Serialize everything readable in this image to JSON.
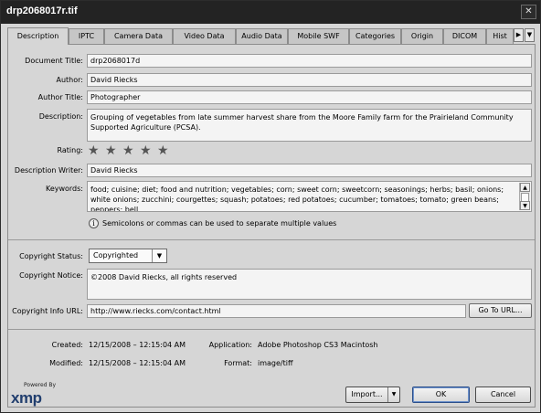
{
  "window": {
    "title": "drp2068017r.tif",
    "close_glyph": "✕"
  },
  "tabs": [
    {
      "label": "Description"
    },
    {
      "label": "IPTC"
    },
    {
      "label": "Camera Data"
    },
    {
      "label": "Video Data"
    },
    {
      "label": "Audio Data"
    },
    {
      "label": "Mobile SWF"
    },
    {
      "label": "Categories"
    },
    {
      "label": "Origin"
    },
    {
      "label": "DICOM"
    },
    {
      "label": "Hist"
    }
  ],
  "tab_nav": {
    "next_glyph": "▶",
    "menu_glyph": "▼"
  },
  "fields": {
    "document_title": {
      "label": "Document Title:",
      "value": "drp2068017d"
    },
    "author": {
      "label": "Author:",
      "value": "David Riecks"
    },
    "author_title": {
      "label": "Author Title:",
      "value": "Photographer"
    },
    "description": {
      "label": "Description:",
      "value": "Grouping of vegetables from late summer harvest share from the Moore Family farm for the Prairieland Community Supported Agriculture (PCSA)."
    },
    "rating": {
      "label": "Rating:",
      "stars": 0,
      "max": 5,
      "star_glyph": "★"
    },
    "description_writer": {
      "label": "Description Writer:",
      "value": "David Riecks"
    },
    "keywords": {
      "label": "Keywords:",
      "value": "food; cuisine; diet; food and nutrition; vegetables; corn; sweet corn; sweetcorn; seasonings; herbs; basil; onions; white onions; zucchini; courgettes; squash; potatoes; red potatoes; cucumber; tomatoes; tomato; green beans; peppers; bell"
    },
    "keywords_hint": "Semicolons or commas can be used to separate multiple values",
    "copyright_status": {
      "label": "Copyright Status:",
      "value": "Copyrighted"
    },
    "copyright_notice": {
      "label": "Copyright Notice:",
      "value": "©2008 David Riecks, all rights reserved"
    },
    "copyright_url": {
      "label": "Copyright Info URL:",
      "value": "http://www.riecks.com/contact.html",
      "button": "Go To URL..."
    }
  },
  "meta": {
    "created_label": "Created:",
    "created_value": "12/15/2008 – 12:15:04 AM",
    "modified_label": "Modified:",
    "modified_value": "12/15/2008 – 12:15:04 AM",
    "application_label": "Application:",
    "application_value": "Adobe Photoshop CS3 Macintosh",
    "format_label": "Format:",
    "format_value": "image/tiff"
  },
  "footer": {
    "powered_by": "Powered By",
    "logo": "xmp",
    "import_label": "Import...",
    "ok_label": "OK",
    "cancel_label": "Cancel"
  }
}
